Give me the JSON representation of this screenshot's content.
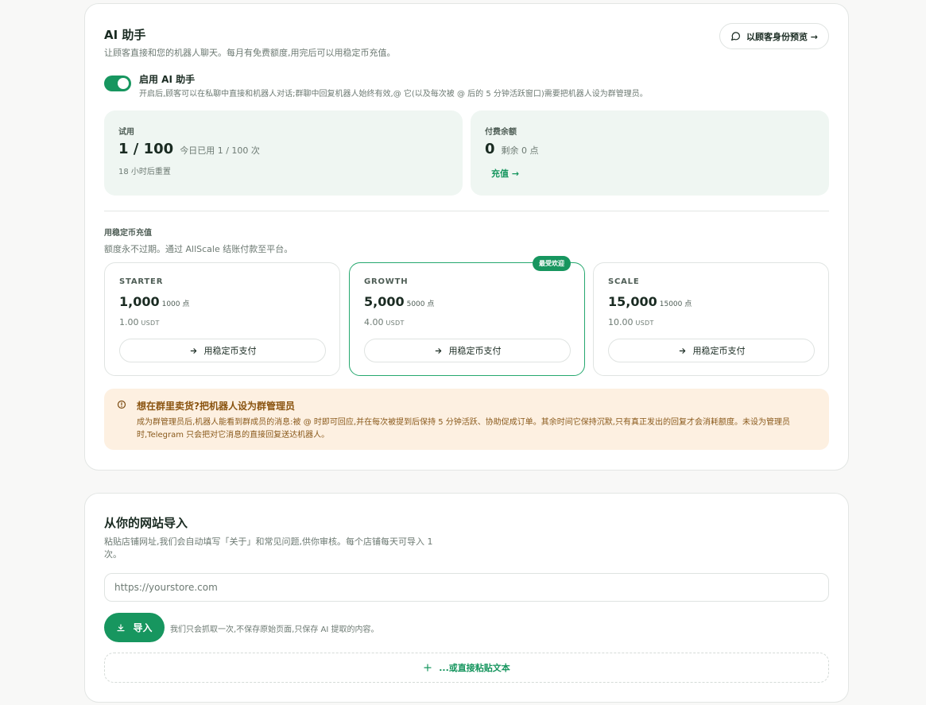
{
  "ai_assistant": {
    "title": "AI 助手",
    "subtitle": "让顾客直接和您的机器人聊天。每月有免费额度,用完后可以用稳定币充值。",
    "preview_button": "以顾客身份预览 →",
    "toggle": {
      "label": "启用 AI 助手",
      "enabled": true,
      "description": "开启后,顾客可以在私聊中直接和机器人对话;群聊中回复机器人始终有效,@ 它(以及每次被 @ 后的 5 分钟活跃窗口)需要把机器人设为群管理员。"
    },
    "trial": {
      "label": "试用",
      "value": "1 / 100",
      "note": "今日已用 1 / 100 次",
      "reset": "18 小时后重置"
    },
    "paid": {
      "label": "付费余额",
      "value": "0",
      "note": "剩余 0 点",
      "recharge_link": "充值 →"
    },
    "recharge": {
      "title": "用稳定币充值",
      "subtitle": "额度永不过期。通过 AllScale 结账付款至平台。",
      "plans": [
        {
          "name": "STARTER",
          "points": "1,000",
          "points_note": "1000 点",
          "price": "1.00",
          "currency": "USDT",
          "button": "用稳定币支付",
          "badge": "",
          "featured": false
        },
        {
          "name": "GROWTH",
          "points": "5,000",
          "points_note": "5000 点",
          "price": "4.00",
          "currency": "USDT",
          "button": "用稳定币支付",
          "badge": "最受欢迎",
          "featured": true
        },
        {
          "name": "SCALE",
          "points": "15,000",
          "points_note": "15000 点",
          "price": "10.00",
          "currency": "USDT",
          "button": "用稳定币支付",
          "badge": "",
          "featured": false
        }
      ]
    },
    "notice": {
      "title": "想在群里卖货?把机器人设为群管理员",
      "body": "成为群管理员后,机器人能看到群成员的消息:被 @ 时即可回应,并在每次被提到后保持 5 分钟活跃、协助促成订单。其余时间它保持沉默,只有真正发出的回复才会消耗额度。未设为管理员时,Telegram 只会把对它消息的直接回复送达机器人。"
    }
  },
  "import": {
    "title": "从你的网站导入",
    "subtitle_line1": "粘贴店铺网址,我们会自动填写「关于」和常见问题,供你审核。每个店铺每天可导入 1",
    "subtitle_line2": "次。",
    "url_placeholder": "https://yourstore.com",
    "import_button": "导入",
    "import_note": "我们只会抓取一次,不保存原始页面,只保存 AI 提取的内容。",
    "paste_button": "...或直接粘贴文本"
  },
  "colors": {
    "accent": "#17965f",
    "stat_bg": "#eff6f2",
    "notice_bg": "#fdf0e1",
    "notice_text": "#8a5410"
  },
  "icons": [
    "chat-bubble-icon",
    "arrow-right-icon",
    "alert-circle-icon",
    "download-icon",
    "plus-icon"
  ]
}
